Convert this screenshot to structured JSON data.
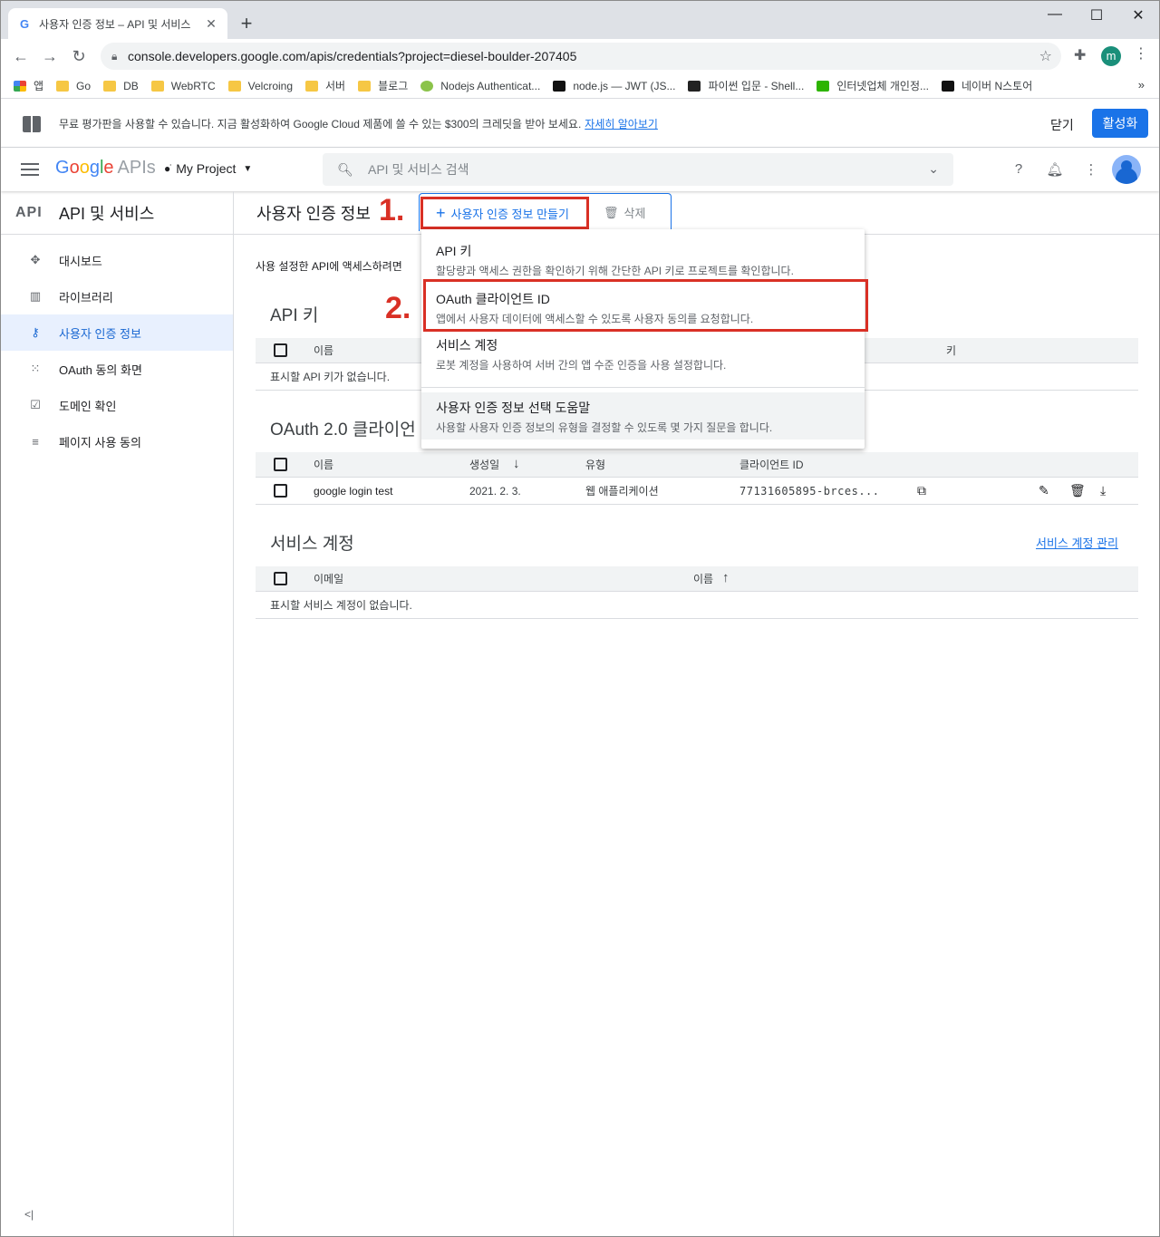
{
  "browser": {
    "tab_title": "사용자 인증 정보 – API 및 서비스",
    "tab_favicon": "G",
    "new_tab_symbol": "+",
    "url": "console.developers.google.com/apis/credentials?project=diesel-boulder-207405",
    "profile_letter": "m",
    "bookmarks": [
      "앱",
      "Go",
      "DB",
      "WebRTC",
      "Velcroing",
      "서버",
      "블로그",
      "Nodejs Authenticat...",
      "node.js — JWT (JS...",
      "파이썬 입문 - Shell...",
      "인터넷업체 개인정...",
      "네이버 N스토어"
    ],
    "bookmarks_more": "»"
  },
  "banner": {
    "text": "무료 평가판을 사용할 수 있습니다. 지금 활성화하여 Google Cloud 제품에 쓸 수 있는 $300의 크레딧을 받아 보세요.",
    "link": "자세히 알아보기",
    "close": "닫기",
    "activate": "활성화"
  },
  "header": {
    "logo_google": [
      "G",
      "o",
      "o",
      "g",
      "l",
      "e"
    ],
    "logo_apis": "APIs",
    "project": "My Project",
    "search_placeholder": "API 및 서비스 검색"
  },
  "sidebar": {
    "logo": "API",
    "title": "API 및 서비스",
    "items": [
      {
        "label": "대시보드",
        "icon": "✥"
      },
      {
        "label": "라이브러리",
        "icon": "▥"
      },
      {
        "label": "사용자 인증 정보",
        "icon": "⚷"
      },
      {
        "label": "OAuth 동의 화면",
        "icon": "⁙"
      },
      {
        "label": "도메인 확인",
        "icon": "☑"
      },
      {
        "label": "페이지 사용 동의",
        "icon": "≡"
      }
    ],
    "collapse_icon": "<|"
  },
  "main": {
    "title": "사용자 인증 정보",
    "create_label": "사용자 인증 정보 만들기",
    "delete_label": "삭제",
    "step1": "1.",
    "step2": "2.",
    "intro": "사용 설정한 API에 액세스하려면",
    "api_keys": {
      "title": "API 키",
      "col_name": "이름",
      "col_key": "키",
      "empty": "표시할 API 키가 없습니다."
    },
    "oauth": {
      "title": "OAuth 2.0 클라이언",
      "col_name": "이름",
      "col_created": "생성일",
      "col_type": "유형",
      "col_client_id": "클라이언트 ID",
      "rows": [
        {
          "name": "google login test",
          "created": "2021. 2. 3.",
          "type": "웹 애플리케이션",
          "client_id": "77131605895-brces..."
        }
      ]
    },
    "service": {
      "title": "서비스 계정",
      "manage_link": "서비스 계정 관리",
      "col_email": "이메일",
      "col_name": "이름",
      "empty": "표시할 서비스 계정이 없습니다."
    }
  },
  "dropdown": {
    "items": [
      {
        "title": "API 키",
        "desc": "할당량과 액세스 권한을 확인하기 위해 간단한 API 키로 프로젝트를 확인합니다."
      },
      {
        "title": "OAuth 클라이언트 ID",
        "desc": "앱에서 사용자 데이터에 액세스할 수 있도록 사용자 동의를 요청합니다."
      },
      {
        "title": "서비스 계정",
        "desc": "로봇 계정을 사용하여 서버 간의 앱 수준 인증을 사용 설정합니다."
      },
      {
        "title": "사용자 인증 정보 선택 도움말",
        "desc": "사용할 사용자 인증 정보의 유형을 결정할 수 있도록 몇 가지 질문을 합니다."
      }
    ]
  },
  "colors": {
    "accent": "#1a73e8",
    "annotation": "#d93025"
  }
}
